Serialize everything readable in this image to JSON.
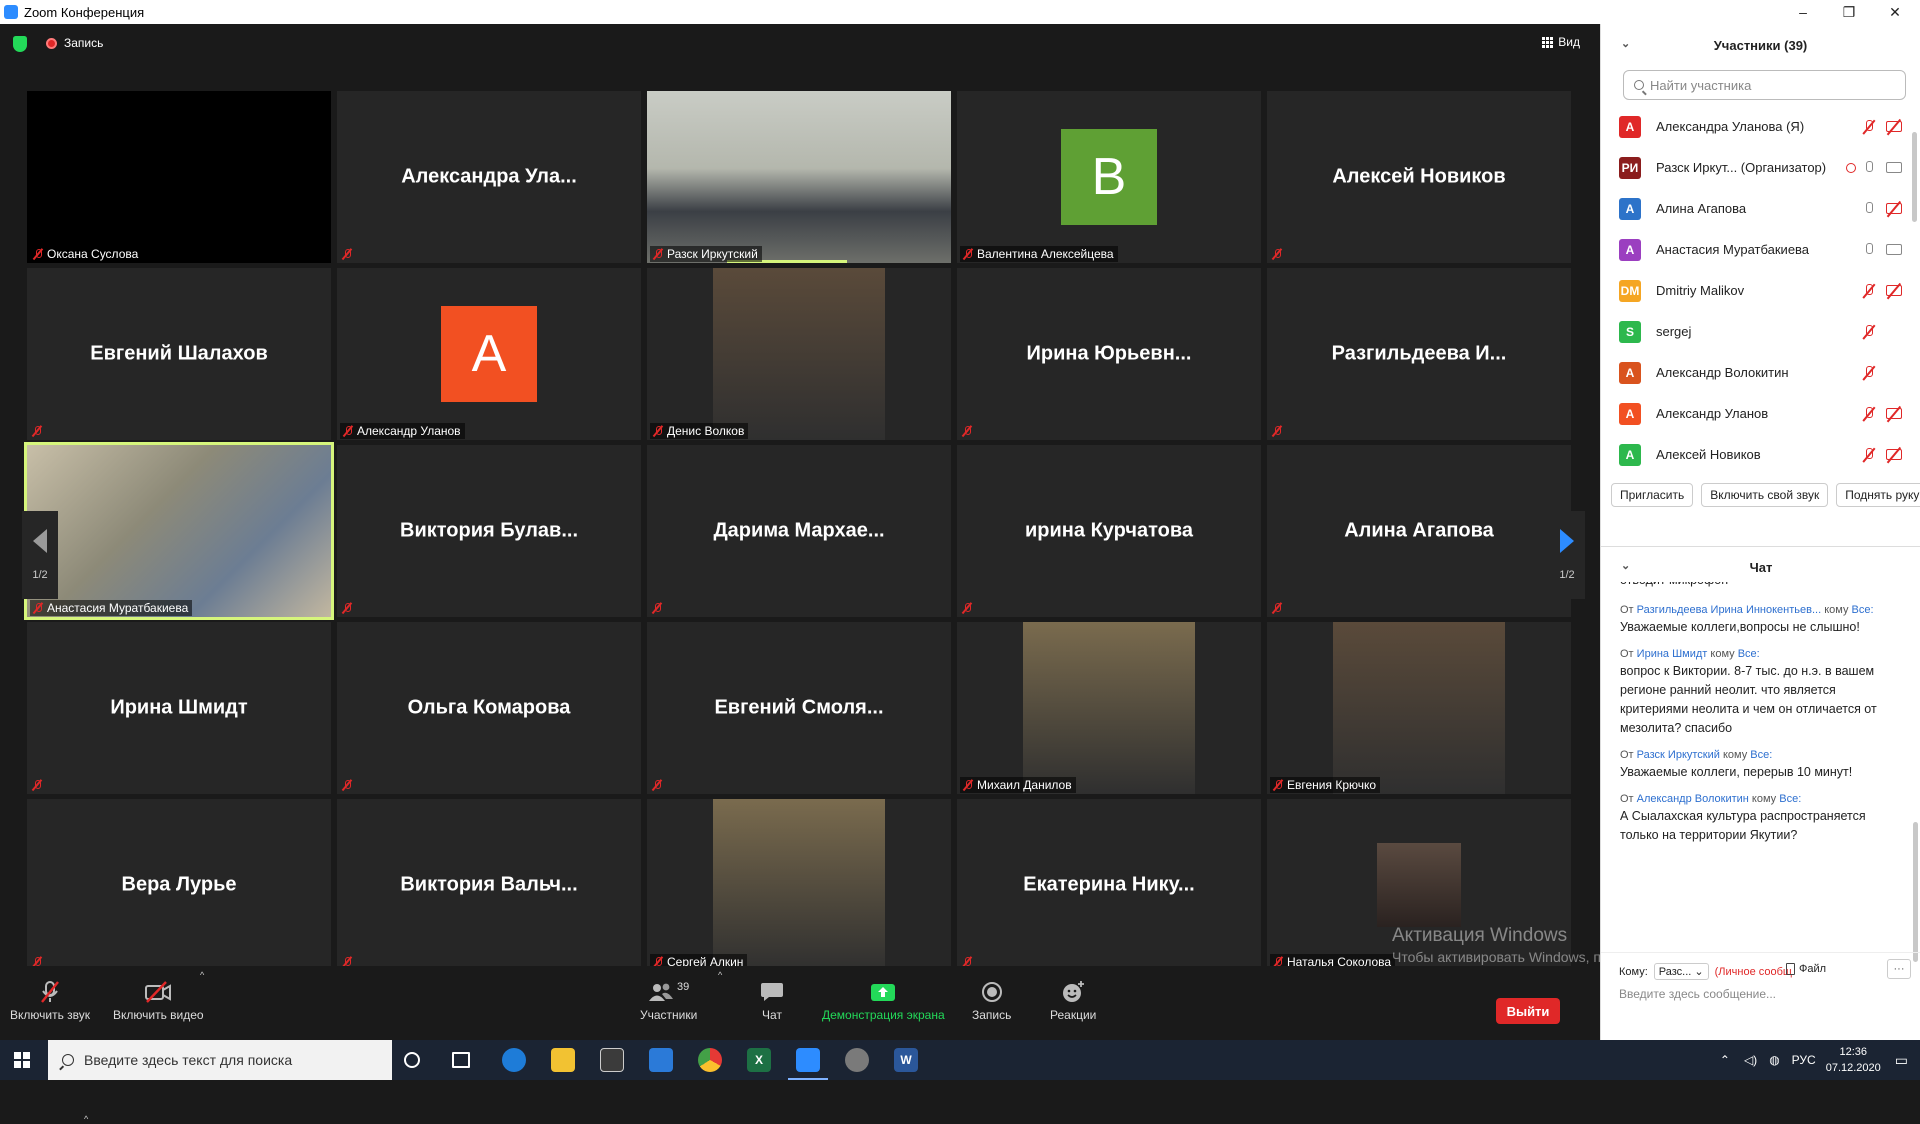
{
  "window": {
    "title": "Zoom Конференция",
    "minimize": "–",
    "maximize": "❐",
    "close": "✕"
  },
  "topbar": {
    "recording_label": "Запись",
    "view_label": "Вид"
  },
  "tiles": [
    {
      "type": "black",
      "name": "Оксана Суслова"
    },
    {
      "type": "text",
      "big": "Александра  Ула...",
      "name": ""
    },
    {
      "type": "video",
      "name": "Разск Иркутский",
      "speaking": true
    },
    {
      "type": "avatar",
      "letter": "В",
      "color": "#5fa034",
      "name": "Валентина Алексейцева"
    },
    {
      "type": "text",
      "big": "Алексей Новиков",
      "name": ""
    },
    {
      "type": "text",
      "big": "Евгений Шалахов",
      "name": ""
    },
    {
      "type": "avatar",
      "letter": "А",
      "color": "#f25022",
      "name": "Александр Уланов"
    },
    {
      "type": "photo",
      "name": "Денис Волков"
    },
    {
      "type": "text",
      "big": "Ирина  Юрьевн...",
      "name": ""
    },
    {
      "type": "text",
      "big": "Разгильдеева  И...",
      "name": ""
    },
    {
      "type": "video",
      "name": "Анастасия Муратбакиева",
      "active": true
    },
    {
      "type": "text",
      "big": "Виктория  Булав...",
      "name": ""
    },
    {
      "type": "text",
      "big": "Дарима  Мархае...",
      "name": ""
    },
    {
      "type": "text",
      "big": "ирина Курчатова",
      "name": ""
    },
    {
      "type": "text",
      "big": "Алина Агапова",
      "name": ""
    },
    {
      "type": "text",
      "big": "Ирина Шмидт",
      "name": ""
    },
    {
      "type": "text",
      "big": "Ольга Комарова",
      "name": ""
    },
    {
      "type": "text",
      "big": "Евгений  Смоля...",
      "name": ""
    },
    {
      "type": "photo",
      "name": "Михаил Данилов"
    },
    {
      "type": "photo",
      "name": "Евгения Крючко"
    },
    {
      "type": "text",
      "big": "Вера Лурье",
      "name": ""
    },
    {
      "type": "text",
      "big": "Виктория  Вальч...",
      "name": ""
    },
    {
      "type": "photo",
      "name": "Сергей Алкин"
    },
    {
      "type": "text",
      "big": "Екатерина  Нику...",
      "name": ""
    },
    {
      "type": "smallphoto",
      "name": "Наталья Соколова"
    }
  ],
  "paging": {
    "left": "1/2",
    "right": "1/2"
  },
  "watermark": {
    "title": "Активация Windows",
    "subtitle": "Чтобы активировать Windows, перейдите в раздел \"Параметры\"."
  },
  "toolbar": {
    "unmute": "Включить звук",
    "start_video": "Включить видео",
    "participants": "Участники",
    "participants_count": "39",
    "chat": "Чат",
    "share": "Демонстрация экрана",
    "record": "Запись",
    "reactions": "Реакции",
    "leave": "Выйти"
  },
  "participants_panel": {
    "title": "Участники (39)",
    "search_placeholder": "Найти участника",
    "list": [
      {
        "initials": "А",
        "color": "#e02828",
        "name": "Александра Уланова (Я)",
        "mic": "off",
        "cam": "off"
      },
      {
        "initials": "РИ",
        "color": "#8b1d1d",
        "name": "Разск Иркут... (Организатор)",
        "mic": "on",
        "cam": "on",
        "rec": true
      },
      {
        "initials": "А",
        "color": "#2d73c9",
        "name": "Алина Агапова",
        "mic": "on",
        "cam": "off"
      },
      {
        "initials": "А",
        "color": "#9b3fc0",
        "name": "Анастасия Муратбакиева",
        "mic": "on",
        "cam": "on"
      },
      {
        "initials": "DM",
        "color": "#f5a623",
        "name": "Dmitriy Malikov",
        "mic": "off",
        "cam": "off"
      },
      {
        "initials": "S",
        "color": "#2db84d",
        "name": "sergej",
        "mic": "off",
        "cam": ""
      },
      {
        "initials": "А",
        "color": "#d9531e",
        "name": "Александр Волокитин",
        "mic": "off",
        "cam": ""
      },
      {
        "initials": "А",
        "color": "#f25022",
        "name": "Александр Уланов",
        "mic": "off",
        "cam": "off"
      },
      {
        "initials": "А",
        "color": "#2db84d",
        "name": "Алексей Новиков",
        "mic": "off",
        "cam": "off"
      }
    ],
    "buttons": {
      "invite": "Пригласить",
      "unmute_self": "Включить свой звук",
      "raise_hand": "Поднять руку"
    }
  },
  "chat": {
    "title": "Чат",
    "partial_line": "отводит микрофон",
    "messages": [
      {
        "from_prefix": "От",
        "from": "Разгильдеева Ирина Иннокентьев...",
        "to_prefix": "кому",
        "to": "Все:",
        "text": "Уважаемые коллеги,вопросы не слышно!"
      },
      {
        "from_prefix": "От",
        "from": "Ирина Шмидт",
        "to_prefix": "кому",
        "to": "Все:",
        "text": "вопрос к Виктории. 8-7 тыс. до н.э. в вашем регионе ранний неолит. что является критериями неолита и чем он отличается от мезолита? спасибо"
      },
      {
        "from_prefix": "От",
        "from": "Разск Иркутский",
        "to_prefix": "кому",
        "to": "Все:",
        "text": "Уважаемые коллеги, перерыв 10 минут!"
      },
      {
        "from_prefix": "От",
        "from": "Александр Волокитин",
        "to_prefix": "кому",
        "to": "Все:",
        "text": "А  Сыалахская культура распространяется только на территории Якутии?"
      }
    ],
    "to_label": "Кому:",
    "to_value": "Разс...",
    "private_label": "(Личное сообщ",
    "file_label": "Файл",
    "more_label": "···",
    "input_placeholder": "Введите здесь сообщение..."
  },
  "taskbar": {
    "search_placeholder": "Введите здесь текст для поиска",
    "lang": "РУС",
    "time": "12:36",
    "date": "07.12.2020"
  }
}
